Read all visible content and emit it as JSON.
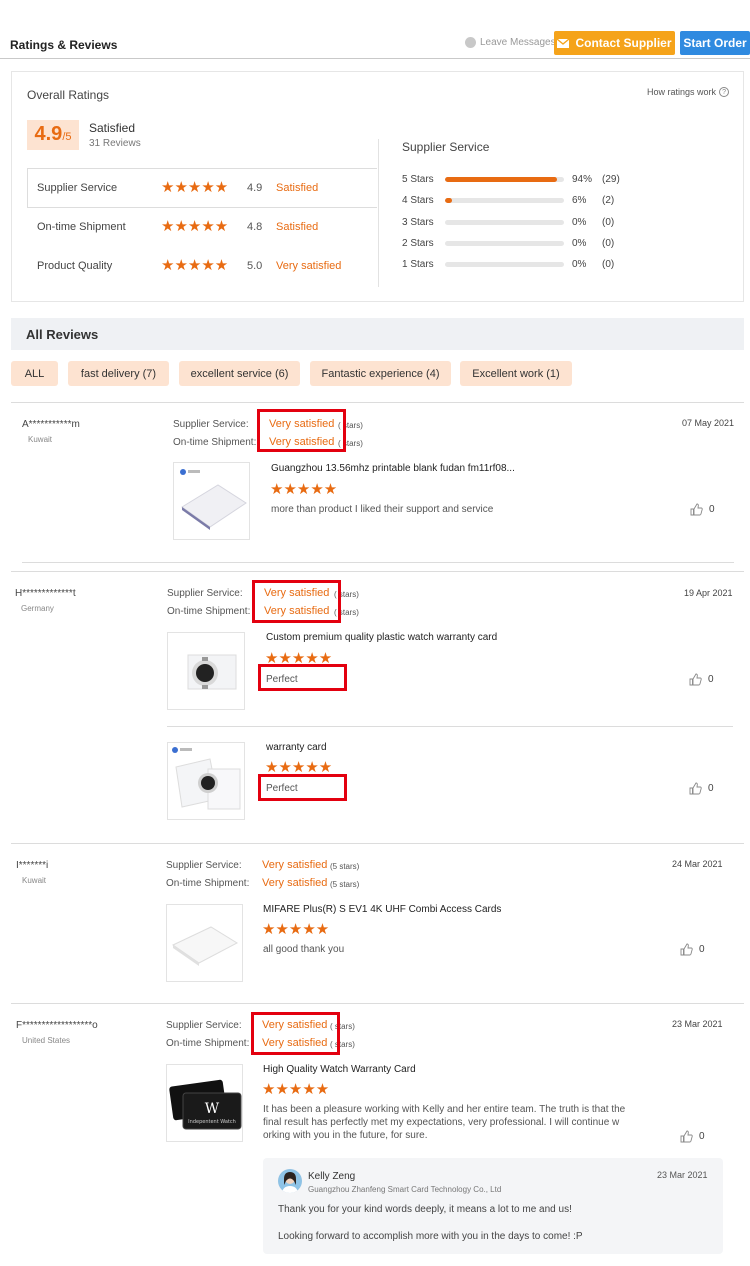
{
  "header": {
    "title": "Ratings & Reviews",
    "leave_messages": "Leave Messages",
    "contact_supplier": "Contact Supplier",
    "start_order": "Start Order"
  },
  "overall": {
    "title": "Overall Ratings",
    "how_ratings_work": "How ratings work",
    "score": "4.9",
    "score_max": "/5",
    "label": "Satisfied",
    "reviews_count": "31 Reviews",
    "ratings": [
      {
        "name": "Supplier Service",
        "stars": "★★★★★",
        "score": "4.9",
        "word": "Satisfied"
      },
      {
        "name": "On-time Shipment",
        "stars": "★★★★★",
        "score": "4.8",
        "word": "Satisfied"
      },
      {
        "name": "Product Quality",
        "stars": "★★★★★",
        "score": "5.0",
        "word": "Very satisfied"
      }
    ],
    "distribution_title": "Supplier Service",
    "distribution": [
      {
        "label": "5 Stars",
        "fraction": 0.94,
        "pct": "94%",
        "count": "(29)"
      },
      {
        "label": "4 Stars",
        "fraction": 0.06,
        "pct": "6%",
        "count": "(2)"
      },
      {
        "label": "3 Stars",
        "fraction": 0,
        "pct": "0%",
        "count": "(0)"
      },
      {
        "label": "2 Stars",
        "fraction": 0,
        "pct": "0%",
        "count": "(0)"
      },
      {
        "label": "1 Stars",
        "fraction": 0,
        "pct": "0%",
        "count": "(0)"
      }
    ]
  },
  "all_reviews": {
    "title": "All Reviews",
    "filters": [
      "ALL",
      "fast delivery (7)",
      "excellent service (6)",
      "Fantastic experience (4)",
      "Excellent work (1)"
    ]
  },
  "labels": {
    "supplier_service": "Supplier Service:",
    "ontime_shipment": "On-time Shipment:",
    "five_stars_full": "(5 stars)",
    "five_stars_clipped": "( stars)",
    "five_stars_clipped2": "(5 stars)"
  },
  "reviews": [
    {
      "reviewer": "A***********m",
      "country": "Kuwait",
      "date": "07 May 2021",
      "supplier_service": "Very satisfied",
      "shipment": "Very satisfied",
      "products": [
        {
          "title": "Guangzhou 13.56mhz printable blank fudan fm11rf08...",
          "stars": "★★★★★",
          "text": "more than product I liked their support and service",
          "likes": "0"
        }
      ]
    },
    {
      "reviewer": "H*************t",
      "country": "Germany",
      "date": "19 Apr 2021",
      "supplier_service": "Very satisfied",
      "shipment": "Very satisfied",
      "products": [
        {
          "title": "Custom premium quality plastic watch warranty card",
          "stars": "★★★★★",
          "text": "Perfect",
          "likes": "0"
        },
        {
          "title": "warranty card",
          "stars": "★★★★★",
          "text": "Perfect",
          "likes": "0"
        }
      ]
    },
    {
      "reviewer": "I*******i",
      "country": "Kuwait",
      "date": "24 Mar 2021",
      "supplier_service": "Very satisfied",
      "shipment": "Very satisfied",
      "products": [
        {
          "title": "MIFARE Plus(R) S EV1 4K UHF Combi Access Cards",
          "stars": "★★★★★",
          "text": "all good thank you",
          "likes": "0"
        }
      ]
    },
    {
      "reviewer": "F******************o",
      "country": "United States",
      "date": "23 Mar 2021",
      "supplier_service": "Very satisfied",
      "shipment": "Very satisfied",
      "products": [
        {
          "title": "High Quality Watch Warranty Card",
          "stars": "★★★★★",
          "text_lines": [
            "It has been a pleasure working with Kelly and her entire team. The truth is that the",
            "final result has perfectly met my expectations, very professional. I will continue w",
            "orking with you in the future, for sure."
          ],
          "likes": "0"
        }
      ],
      "reply": {
        "name": "Kelly Zeng",
        "company": "Guangzhou Zhanfeng Smart Card Technology Co., Ltd",
        "date": "23 Mar 2021",
        "line1": "Thank you for your kind words deeply, it means a lot to me and us!",
        "line2": "Looking forward to accomplish more with you in the days to come! :P"
      }
    }
  ],
  "thumb_text": {
    "brand_card_text": "Indepentent Watch"
  }
}
